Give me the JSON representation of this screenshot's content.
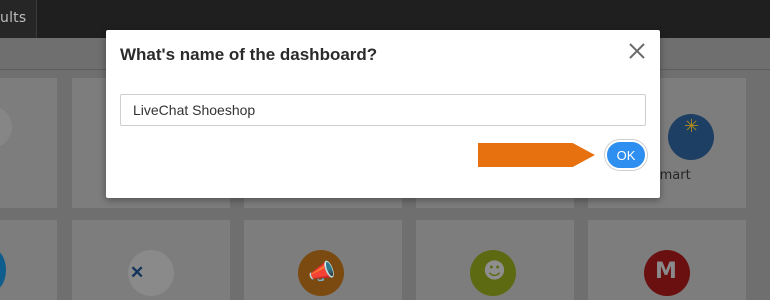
{
  "topbar": {
    "tab_label": "ults"
  },
  "background": {
    "integration_label": "lmart"
  },
  "dialog": {
    "title": "What's name of the dashboard?",
    "input_value": "LiveChat Shoeshop",
    "ok_label": "OK",
    "annotation_color": "#e8710f",
    "accent": "#2e8ff0"
  },
  "icons": {
    "close": "close-icon",
    "walmart": "walmart-logo-icon",
    "jira": "jira-logo-icon",
    "megaphone": "megaphone-icon",
    "surveymonkey": "surveymonkey-icon",
    "gmail": "gmail-icon"
  }
}
